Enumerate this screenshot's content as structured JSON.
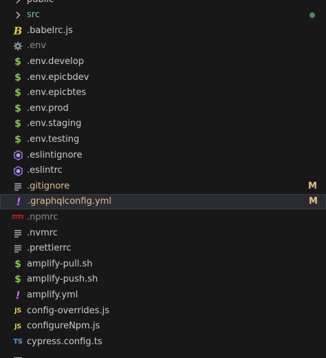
{
  "explorer": {
    "accent_modified": "#e2c08d",
    "accent_untracked": "#73c991",
    "items": [
      {
        "label": "public",
        "icon": "chevron-right-icon",
        "color": "#cccccc"
      },
      {
        "label": "src",
        "icon": "chevron-right-icon",
        "color": "#73c991",
        "badge_dot": "#4d8d5f"
      },
      {
        "label": ".babelrc.js",
        "icon": "babel-icon"
      },
      {
        "label": ".env",
        "icon": "gear-icon",
        "color": "#8c8c8c"
      },
      {
        "label": ".env.develop",
        "icon": "dollar-icon"
      },
      {
        "label": ".env.epicbdev",
        "icon": "dollar-icon"
      },
      {
        "label": ".env.epicbtes",
        "icon": "dollar-icon"
      },
      {
        "label": ".env.prod",
        "icon": "dollar-icon"
      },
      {
        "label": ".env.staging",
        "icon": "dollar-icon"
      },
      {
        "label": ".env.testing",
        "icon": "dollar-icon"
      },
      {
        "label": ".eslintignore",
        "icon": "eslint-icon"
      },
      {
        "label": ".eslintrc",
        "icon": "eslint-icon"
      },
      {
        "label": ".gitignore",
        "icon": "lines-icon",
        "color": "#e2c08d",
        "badge": "M"
      },
      {
        "label": ".graphqlconfig.yml",
        "icon": "exclamation-icon",
        "color": "#e2c08d",
        "badge": "M",
        "selected": true
      },
      {
        "label": ".npmrc",
        "icon": "npm-icon",
        "color": "#8c8c8c"
      },
      {
        "label": ".nvmrc",
        "icon": "lines-icon"
      },
      {
        "label": ".prettierrc",
        "icon": "lines-icon"
      },
      {
        "label": "amplify-pull.sh",
        "icon": "dollar-icon"
      },
      {
        "label": "amplify-push.sh",
        "icon": "dollar-icon"
      },
      {
        "label": "amplify.yml",
        "icon": "exclamation-icon"
      },
      {
        "label": "config-overrides.js",
        "icon": "js-icon"
      },
      {
        "label": "configureNpm.js",
        "icon": "js-icon"
      },
      {
        "label": "cypress.config.ts",
        "icon": "ts-icon"
      },
      {
        "label": "",
        "icon": "partial-icon"
      }
    ]
  }
}
